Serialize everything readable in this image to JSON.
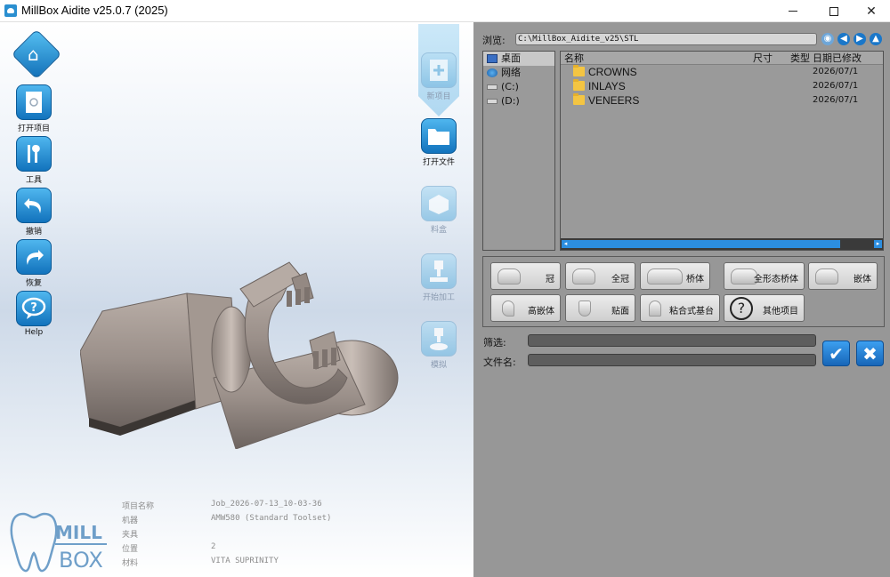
{
  "window": {
    "title": "MillBox Aidite v25.0.7 (2025)"
  },
  "toolbar_left": [
    {
      "label": "打开项目",
      "icon": "open-project-icon"
    },
    {
      "label": "工具",
      "icon": "tools-icon"
    },
    {
      "label": "撤销",
      "icon": "undo-icon"
    },
    {
      "label": "恢复",
      "icon": "redo-icon"
    },
    {
      "label": "Help",
      "icon": "help-icon"
    }
  ],
  "toolbar_right": [
    {
      "label": "新项目",
      "icon": "new-project-icon",
      "enabled": false
    },
    {
      "label": "打开文件",
      "icon": "open-file-icon",
      "enabled": true
    },
    {
      "label": "料盒",
      "icon": "material-box-icon",
      "enabled": false
    },
    {
      "label": "开始加工",
      "icon": "start-machining-icon",
      "enabled": false
    },
    {
      "label": "模拟",
      "icon": "simulation-icon",
      "enabled": false
    }
  ],
  "job_info": [
    {
      "key": "项目名称",
      "value": "Job_2026-07-13_10-03-36"
    },
    {
      "key": "机器",
      "value": "AMW580 (Standard Toolset)"
    },
    {
      "key": "夹具",
      "value": ""
    },
    {
      "key": "位置",
      "value": "2"
    },
    {
      "key": "材料",
      "value": "VITA SUPRINITY"
    }
  ],
  "browser": {
    "label": "浏览:",
    "path": "C:\\MillBox_Aidite_v25\\STL",
    "tree": [
      {
        "label": "桌面",
        "selected": true
      },
      {
        "label": "网络",
        "selected": false
      },
      {
        "label": "(C:)",
        "selected": false
      },
      {
        "label": "(D:)",
        "selected": false
      }
    ],
    "columns": {
      "name": "名称",
      "size": "尺寸",
      "type": "类型",
      "modified": "日期已修改"
    },
    "files": [
      {
        "name": "CROWNS",
        "modified": "2026/07/1"
      },
      {
        "name": "INLAYS",
        "modified": "2026/07/1"
      },
      {
        "name": "VENEERS",
        "modified": "2026/07/1"
      }
    ]
  },
  "categories": [
    {
      "label": "冠"
    },
    {
      "label": "全冠"
    },
    {
      "label": "桥体"
    },
    {
      "label": "全形态桥体"
    },
    {
      "label": "嵌体"
    },
    {
      "label": "高嵌体"
    },
    {
      "label": "贴面"
    },
    {
      "label": "粘合式基台"
    },
    {
      "label": "其他项目"
    }
  ],
  "filter": {
    "label": "筛选:",
    "value": ""
  },
  "filename": {
    "label": "文件名:",
    "value": ""
  },
  "logo": {
    "line1": "MILL",
    "line2": "BOX"
  },
  "colors": {
    "accent": "#1a77c9",
    "panel": "#979797"
  }
}
